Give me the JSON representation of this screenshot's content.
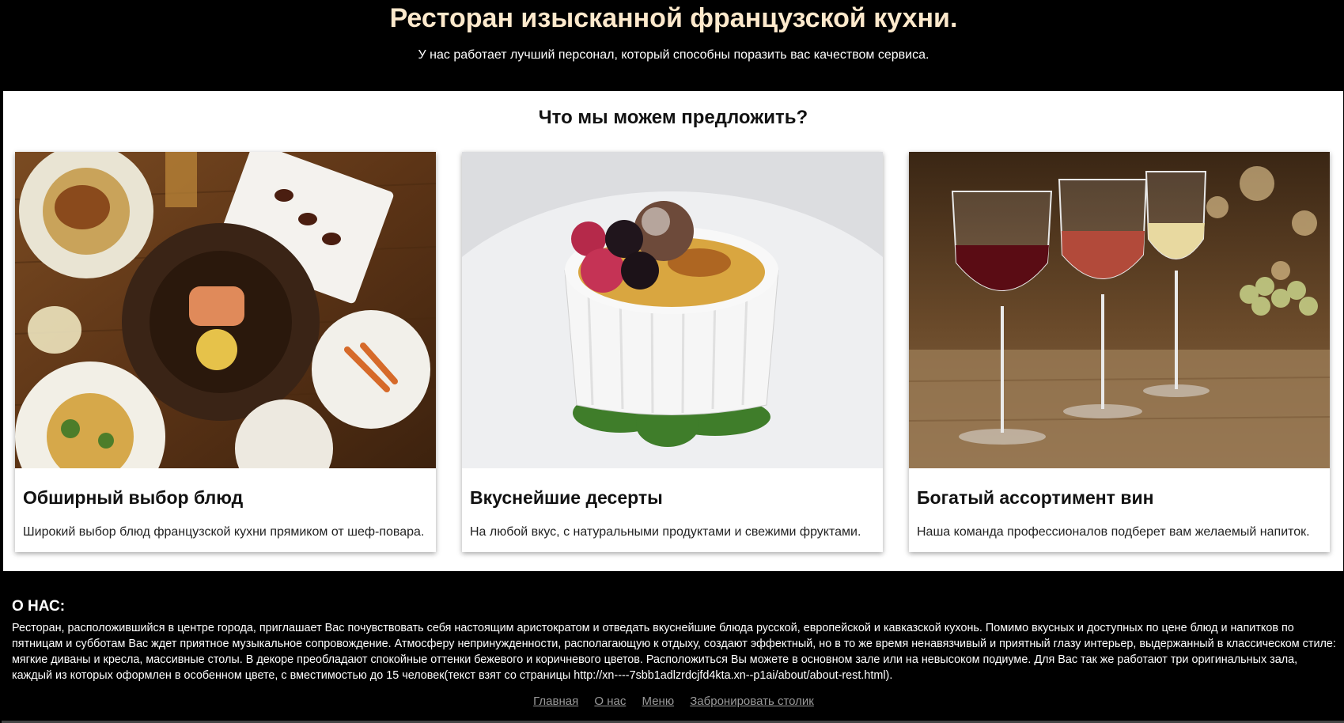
{
  "header": {
    "title": "Ресторан изысканной французской кухни.",
    "subtitle": "У нас работает лучший персонал, который способны поразить вас качеством сервиса."
  },
  "offers": {
    "heading": "Что мы можем предложить?",
    "cards": [
      {
        "image": "food-plates-photo",
        "title": "Обширный выбор блюд",
        "text": "Широкий выбор блюд французской кухни прямиком от шеф-повара."
      },
      {
        "image": "creme-brulee-dessert-photo",
        "title": "Вкуснейшие десерты",
        "text": "На любой вкус, с натуральными продуктами и свежими фруктами."
      },
      {
        "image": "wine-glasses-photo",
        "title": "Богатый ассортимент вин",
        "text": "Наша команда профессионалов подберет вам желаемый напиток."
      }
    ]
  },
  "about": {
    "heading": "О НАС:",
    "text": "Ресторан, расположившийся в центре города, приглашает Вас почувствовать себя настоящим аристократом и отведать вкуснейшие блюда русской, европейской и кавказской кухонь. Помимо вкусных и доступных по цене блюд и напитков по пятницам и субботам Вас ждет приятное музыкальное сопровождение. Атмосферу непринужденности, располагающую к отдыху, создают эффектный, но в то же время ненавязчивый и приятный глазу интерьер, выдержанный в классическом стиле: мягкие диваны и кресла, массивные столы. В декоре преобладают спокойные оттенки бежевого и коричневого цветов. Расположиться Вы можете в основном зале или на невысоком подиуме. Для Вас так же работают три оригинальных зала, каждый из которых оформлен в особенном цвете, с вместимостью до 15 человек(текст взят со страницы http://xn----7sbb1adlzrdcjfd4kta.xn--p1ai/about/about-rest.html)."
  },
  "footer": {
    "links": [
      "Главная",
      "О нас",
      "Меню",
      "Забронировать столик"
    ]
  },
  "colors": {
    "title": "#fde9cc",
    "background": "#000000",
    "link": "#9a9a9a"
  }
}
